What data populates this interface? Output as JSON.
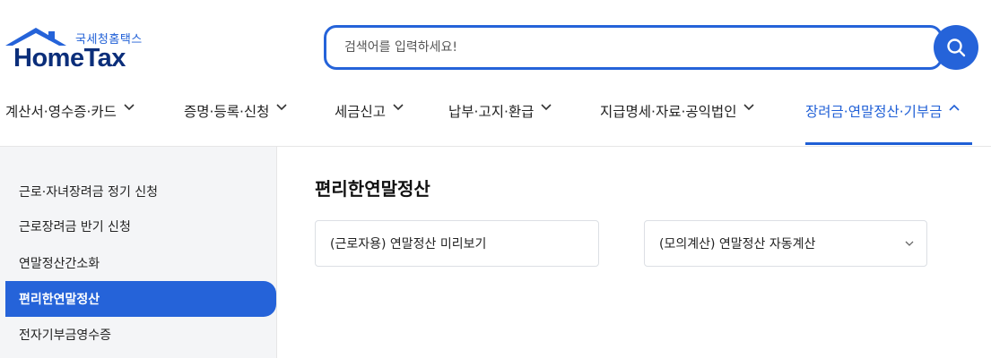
{
  "header": {
    "logo_kr": "국세청홈택스",
    "logo_en": "HomeTax",
    "search_placeholder": "검색어를 입력하세요!"
  },
  "nav": {
    "items": [
      {
        "label": "계산서·영수증·카드"
      },
      {
        "label": "증명·등록·신청"
      },
      {
        "label": "세금신고"
      },
      {
        "label": "납부·고지·환급"
      },
      {
        "label": "지급명세·자료·공익법인"
      },
      {
        "label": "장려금·연말정산·기부금"
      }
    ],
    "active_index": 5
  },
  "sidebar": {
    "items": [
      {
        "label": "근로·자녀장려금 정기 신청"
      },
      {
        "label": "근로장려금 반기 신청"
      },
      {
        "label": "연말정산간소화"
      },
      {
        "label": "편리한연말정산"
      },
      {
        "label": "전자기부금영수증"
      }
    ],
    "active_index": 3
  },
  "main": {
    "title": "편리한연말정산",
    "cards": [
      {
        "label": "(근로자용) 연말정산 미리보기"
      },
      {
        "label": "(모의계산) 연말정산 자동계산"
      }
    ]
  },
  "colors": {
    "accent": "#2563d9",
    "logo_dark": "#0b2e7a",
    "nav_active": "#1f5fd6"
  }
}
